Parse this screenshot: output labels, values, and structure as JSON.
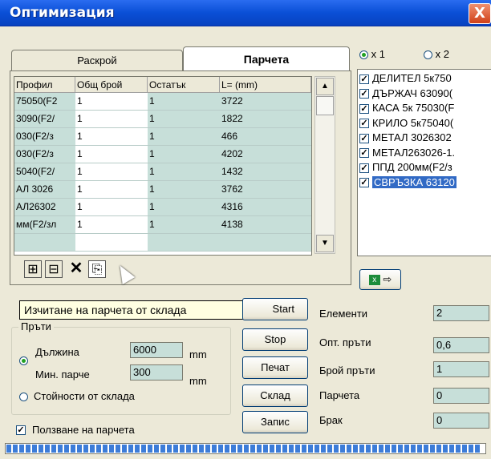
{
  "window": {
    "title": "Оптимизация",
    "close_glyph": "X"
  },
  "tabs": [
    {
      "label": "Раскрой",
      "active": false
    },
    {
      "label": "Парчета",
      "active": true
    }
  ],
  "grid": {
    "headers": [
      "Профил",
      "Общ брой",
      "Остатък",
      "L= (mm)"
    ],
    "rows": [
      [
        "75050(F2",
        "1",
        "1",
        "3722"
      ],
      [
        "3090(F2/",
        "1",
        "1",
        "1822"
      ],
      [
        "030(F2/з",
        "1",
        "1",
        "466"
      ],
      [
        "030(F2/з",
        "1",
        "1",
        "4202"
      ],
      [
        "5040(F2/",
        "1",
        "1",
        "1432"
      ],
      [
        "АЛ 3026",
        "1",
        "1",
        "3762"
      ],
      [
        "АЛ26302",
        "1",
        "1",
        "4316"
      ],
      [
        "мм(F2/зл",
        "1",
        "1",
        "4138"
      ],
      [
        "",
        "",
        "",
        ""
      ]
    ]
  },
  "grid_scroll": {
    "up": "▲",
    "down": "▼"
  },
  "toolbar_icons": [
    {
      "name": "insert-row-icon",
      "glyph": "⊞"
    },
    {
      "name": "edit-row-icon",
      "glyph": "⊟"
    },
    {
      "name": "delete-row-icon",
      "glyph": "✕"
    },
    {
      "name": "load-from-store-icon",
      "glyph": "⎘"
    }
  ],
  "tooltip": "Изчитане на парчета от склада",
  "radio_x": [
    {
      "label": "x 1",
      "selected": true
    },
    {
      "label": "x 2",
      "selected": false
    }
  ],
  "profiles": [
    {
      "label": "ДЕЛИТЕЛ 5к750",
      "checked": true,
      "selected": false
    },
    {
      "label": "ДЪРЖАЧ 63090(",
      "checked": true,
      "selected": false
    },
    {
      "label": "КАСА 5к 75030(F",
      "checked": true,
      "selected": false
    },
    {
      "label": "КРИЛО 5к75040(",
      "checked": true,
      "selected": false
    },
    {
      "label": "МЕТАЛ 3026302",
      "checked": true,
      "selected": false
    },
    {
      "label": "МЕТАЛ263026-1.",
      "checked": true,
      "selected": false
    },
    {
      "label": "ППД 200мм(F2/з",
      "checked": true,
      "selected": false
    },
    {
      "label": "СВРЪЗКА 63120",
      "checked": true,
      "selected": true
    }
  ],
  "excel_button": {
    "icon": "excel-icon",
    "arrow": "⇨"
  },
  "buttons": {
    "start": "Start",
    "stop": "Stop",
    "print": "Печат",
    "store": "Склад",
    "save": "Запис"
  },
  "bars_group": {
    "title": "Пръти",
    "length_label": "Дължина",
    "length_value": "6000",
    "length_unit": "mm",
    "minpiece_label": "Мин. парче",
    "minpiece_value": "300",
    "minpiece_unit": "mm",
    "mode_manual_selected": true,
    "store_values_label": "Стойности от склада"
  },
  "use_pieces": {
    "label": "Ползване на парчета",
    "checked": true,
    "check_glyph": "✓"
  },
  "stats": [
    {
      "label": "Елементи",
      "value": "2"
    },
    {
      "label": "Опт. пръти",
      "value": "0,6"
    },
    {
      "label": "Брой пръти",
      "value": "1"
    },
    {
      "label": "Парчета",
      "value": "0"
    },
    {
      "label": "Брак",
      "value": "0"
    }
  ],
  "progress": {
    "percent": 99
  },
  "colors": {
    "titlebar": "#0a4fd6",
    "grid_cell": "#c7dfd9",
    "selection": "#316ac5",
    "tooltip": "#ffffe1"
  }
}
